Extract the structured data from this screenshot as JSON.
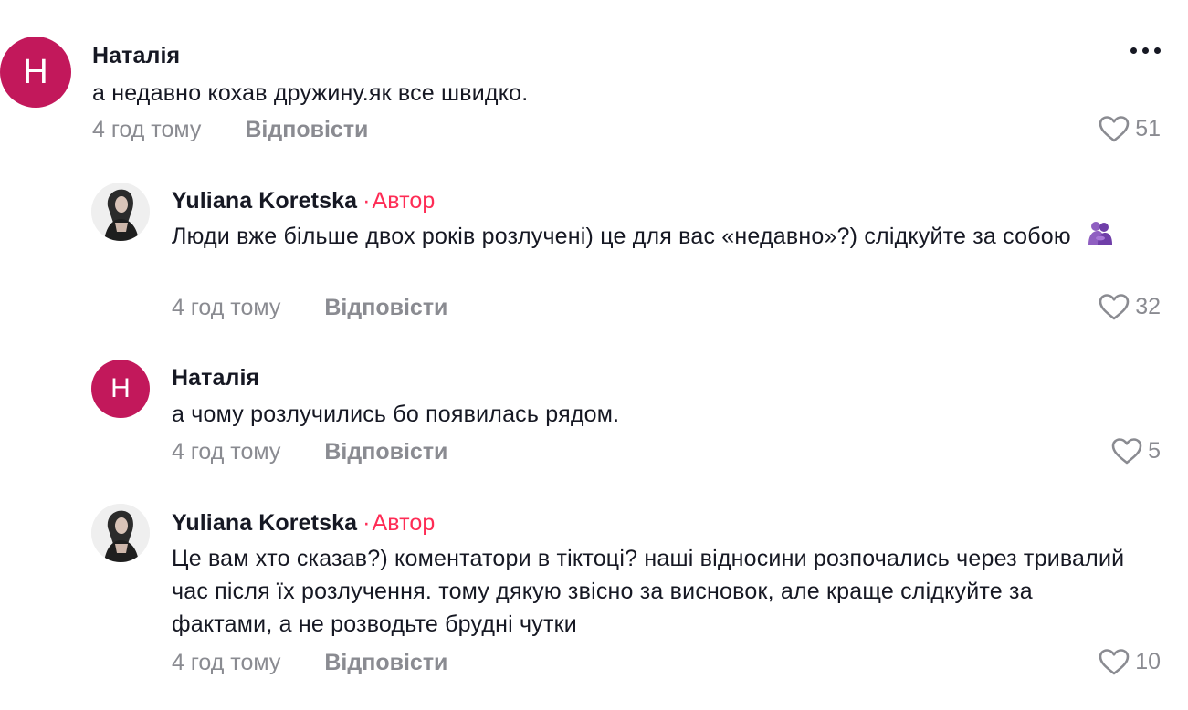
{
  "more_icon": "more-horizontal-icon",
  "like_icon": "heart-outline-icon",
  "colors": {
    "author_tag": "#fe2c55",
    "avatar_letter_bg": "#c2185b",
    "meta_text": "#8a8b91",
    "primary_text": "#161823"
  },
  "comments": [
    {
      "avatar_letter": "Н",
      "username": "Наталія",
      "text": "а недавно кохав дружину.як все швидко.",
      "time": "4 год тому",
      "reply_label": "Відповісти",
      "likes": "51"
    },
    {
      "username": "Yuliana Koretska",
      "author_dot": "·",
      "author_label": "Автор",
      "text": "Люди вже більше двох років розлучені) це для вас «недавно»?) слідкуйте за собою",
      "emoji": "people-hugging-emoji",
      "time": "4 год тому",
      "reply_label": "Відповісти",
      "likes": "32"
    },
    {
      "avatar_letter": "Н",
      "username": "Наталія",
      "text": "а чому розлучились бо появилась рядом.",
      "time": "4 год тому",
      "reply_label": "Відповісти",
      "likes": "5"
    },
    {
      "username": "Yuliana Koretska",
      "author_dot": "·",
      "author_label": "Автор",
      "text": "Це вам хто сказав?) коментатори в тіктоці? наші відносини розпочались через тривалий час після їх розлучення. тому дякую звісно за висновок, але краще слідкуйте за фактами, а не розводьте брудні чутки",
      "time": "4 год тому",
      "reply_label": "Відповісти",
      "likes": "10"
    }
  ]
}
